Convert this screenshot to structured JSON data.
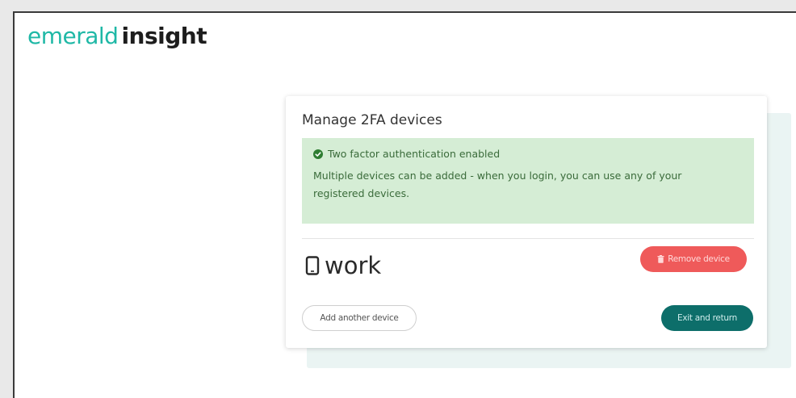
{
  "header": {
    "logo_light": "emerald",
    "logo_bold": "insight"
  },
  "card": {
    "title": "Manage 2FA devices",
    "alert": {
      "icon": "check-circle-icon",
      "heading": "Two factor authentication enabled",
      "body": "Multiple devices can be added - when you login, you can use any of your registered devices.",
      "background_color": "#d5edd5",
      "text_color": "#3a6b3a"
    },
    "device": {
      "icon": "mobile-phone-icon",
      "name": "work",
      "remove_label": "Remove device",
      "remove_icon": "trash-icon"
    },
    "actions": {
      "add_label": "Add another device",
      "exit_label": "Exit and return"
    }
  },
  "colors": {
    "brand_teal": "#1fb8a6",
    "danger": "#ef5a5a",
    "primary_dark_teal": "#0d6e6a"
  }
}
